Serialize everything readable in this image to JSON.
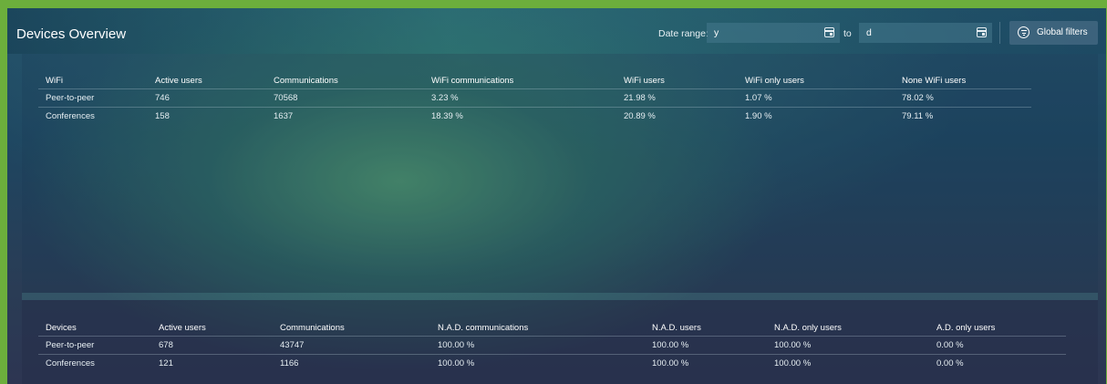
{
  "header": {
    "title": "Devices Overview",
    "date_range_label": "Date range:",
    "date_from": "y",
    "to_label": "to",
    "date_to": "d",
    "global_filters_label": "Global filters"
  },
  "wifi_table": {
    "columns": [
      "WiFi",
      "Active users",
      "Communications",
      "WiFi communications",
      "WiFi users",
      "WiFi only users",
      "None WiFi users"
    ],
    "rows": [
      [
        "Peer-to-peer",
        "746",
        "70568",
        "3.23 %",
        "21.98 %",
        "1.07 %",
        "78.02 %"
      ],
      [
        "Conferences",
        "158",
        "1637",
        "18.39 %",
        "20.89 %",
        "1.90 %",
        "79.11 %"
      ]
    ]
  },
  "devices_table": {
    "columns": [
      "Devices",
      "Active users",
      "Communications",
      "N.A.D. communications",
      "N.A.D. users",
      "N.A.D. only users",
      "A.D. only users"
    ],
    "rows": [
      [
        "Peer-to-peer",
        "678",
        "43747",
        "100.00 %",
        "100.00 %",
        "100.00 %",
        "0.00 %"
      ],
      [
        "Conferences",
        "121",
        "1166",
        "100.00 %",
        "100.00 %",
        "100.00 %",
        "0.00 %"
      ]
    ]
  },
  "colors": {
    "outer_border": "#6cae3c",
    "panel_dark": "#1e4661"
  }
}
